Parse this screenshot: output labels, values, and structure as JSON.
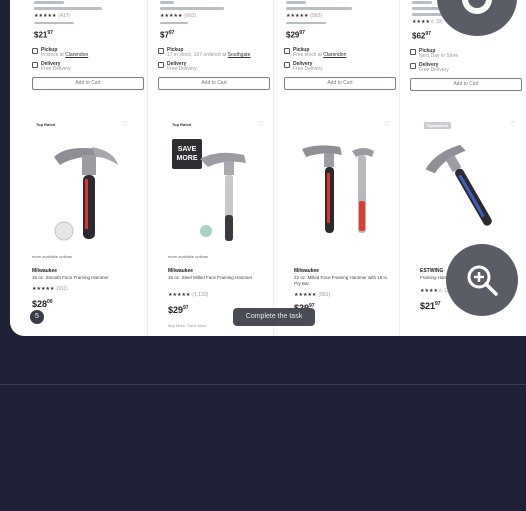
{
  "top_row": [
    {
      "price_main": "$21",
      "price_cents": "97",
      "fulfill1": "Pickup",
      "fulfill1_sub": "In stock at",
      "fulfill1_link": "Clarendon",
      "fulfill2": "Delivery",
      "fulfill2_sub": "Free Delivery",
      "cta": "Add to Cart"
    },
    {
      "price_main": "$7",
      "price_cents": "97",
      "fulfill1": "Pickup",
      "fulfill1_sub": "17 in stock, 167 ordered at",
      "fulfill1_link": "Southgate",
      "fulfill2": "Delivery",
      "fulfill2_sub": "Free Delivery",
      "cta": "Add to Cart"
    },
    {
      "price_main": "$29",
      "price_cents": "97",
      "fulfill1": "Pickup",
      "fulfill1_sub": "Free stock at",
      "fulfill1_link": "Clarendon",
      "fulfill2": "Delivery",
      "fulfill2_sub": "Free Delivery",
      "cta": "Add to Cart"
    },
    {
      "price_main": "$62",
      "price_cents": "97",
      "fulfill1": "Pickup",
      "fulfill1_sub": "Next Day in Store",
      "fulfill1_link": "",
      "fulfill2": "Delivery",
      "fulfill2_sub": "Free Delivery",
      "cta": "Add to Cart"
    }
  ],
  "cards": [
    {
      "badge": "Top Rated",
      "thumbs": "more available options",
      "brand": "Milwaukee",
      "title": "16 oz. Smooth Face Framing Hammer",
      "price_main": "$28",
      "price_cents": "00",
      "note": ""
    },
    {
      "badge": "Top Rated",
      "thumbs": "more available options",
      "brand": "Milwaukee",
      "title": "16 oz. Steel Milled Face Framing Hammer",
      "price_main": "$29",
      "price_cents": "97",
      "note": "Buy More, Save More"
    },
    {
      "badge": "",
      "thumbs": "",
      "brand": "Milwaukee",
      "title": "22 oz. Milled Face Framing Hammer with 18 in. Pry Bar",
      "price_main": "$29",
      "price_cents": "97",
      "note": ""
    },
    {
      "badge": "Sponsored",
      "thumbs": "",
      "brand": "ESTWING",
      "title": "Framing Hammer, Rip Claw, Smooth Face",
      "price_main": "$21",
      "price_cents": "97",
      "note": ""
    }
  ],
  "overlay": {
    "toast": "Complete the task",
    "zoom_label": "zoom-in",
    "save_more_line1": "SAVE",
    "save_more_line2": "MORE"
  }
}
